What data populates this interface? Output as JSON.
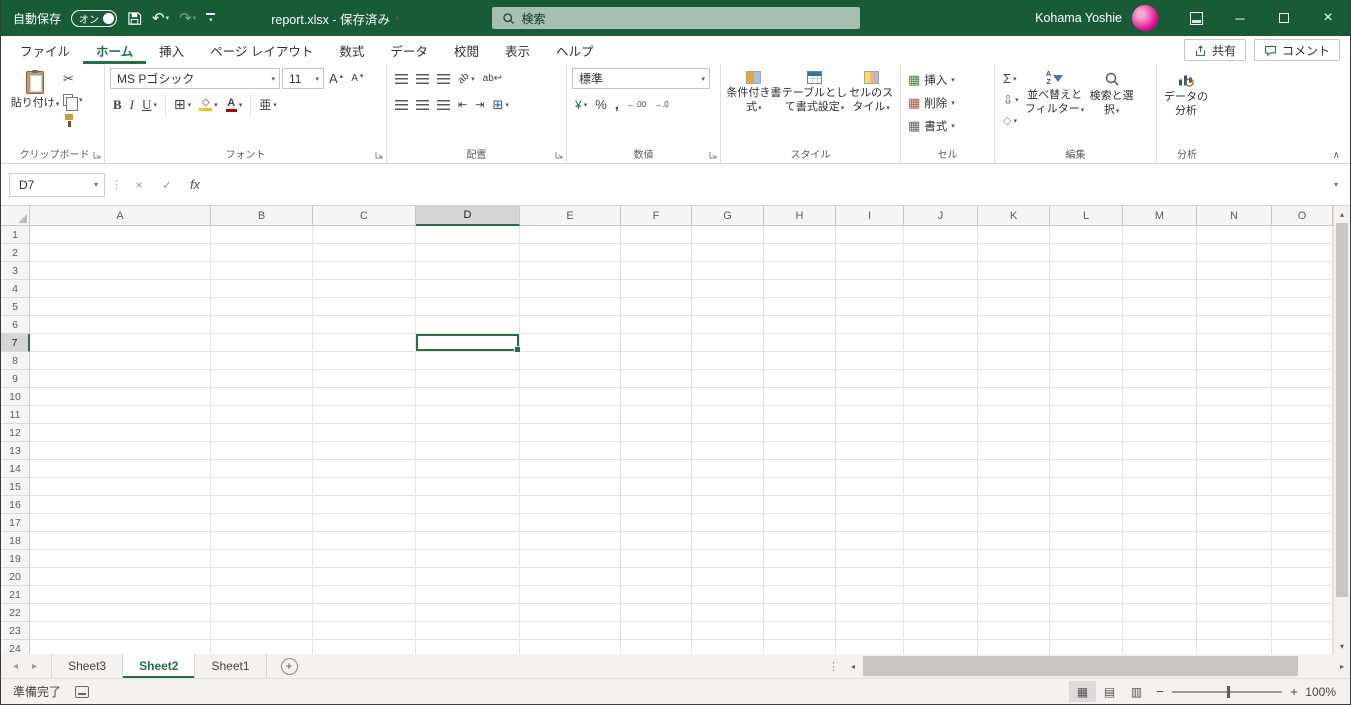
{
  "titlebar": {
    "autosave_label": "自動保存",
    "autosave_state": "オン",
    "document_title": "report.xlsx - 保存済み",
    "search_placeholder": "検索",
    "user_name": "Kohama Yoshie"
  },
  "ribbon_tabs": [
    {
      "label": "ファイル",
      "active": false
    },
    {
      "label": "ホーム",
      "active": true
    },
    {
      "label": "挿入",
      "active": false
    },
    {
      "label": "ページ レイアウト",
      "active": false
    },
    {
      "label": "数式",
      "active": false
    },
    {
      "label": "データ",
      "active": false
    },
    {
      "label": "校閲",
      "active": false
    },
    {
      "label": "表示",
      "active": false
    },
    {
      "label": "ヘルプ",
      "active": false
    }
  ],
  "ribbon_actions": {
    "share": "共有",
    "comments": "コメント"
  },
  "ribbon": {
    "clipboard": {
      "group_label": "クリップボード",
      "paste_label": "貼り付け"
    },
    "font": {
      "group_label": "フォント",
      "font_name": "MS Pゴシック",
      "font_size": "11"
    },
    "alignment": {
      "group_label": "配置"
    },
    "number": {
      "group_label": "数値",
      "number_format": "標準"
    },
    "styles": {
      "group_label": "スタイル",
      "conditional_formatting": "条件付き書式",
      "format_as_table": "テーブルとして書式設定",
      "cell_styles": "セルのスタイル"
    },
    "cells": {
      "group_label": "セル",
      "insert": "挿入",
      "delete": "削除",
      "format": "書式"
    },
    "editing": {
      "group_label": "編集",
      "sort_filter": "並べ替えとフィルター",
      "find_select": "検索と選択"
    },
    "analysis": {
      "group_label": "分析",
      "analyze_data": "データの分析"
    }
  },
  "formula_bar": {
    "name_box": "D7",
    "fx_label": "fx",
    "formula_value": ""
  },
  "grid": {
    "columns": [
      "A",
      "B",
      "C",
      "D",
      "E",
      "F",
      "G",
      "H",
      "I",
      "J",
      "K",
      "L",
      "M",
      "N",
      "O"
    ],
    "rows": [
      "1",
      "2",
      "3",
      "4",
      "5",
      "6",
      "7",
      "8",
      "9",
      "10",
      "11",
      "12",
      "13",
      "14",
      "15",
      "16",
      "17",
      "18",
      "19",
      "20",
      "21",
      "22",
      "23",
      "24"
    ],
    "selected_cell": "D7",
    "selected_column": "D",
    "selected_row": "7"
  },
  "sheet_tabs": {
    "tabs": [
      {
        "label": "Sheet3",
        "active": false
      },
      {
        "label": "Sheet2",
        "active": true
      },
      {
        "label": "Sheet1",
        "active": false
      }
    ]
  },
  "status_bar": {
    "status": "準備完了",
    "zoom_level": "100%"
  },
  "icons": {
    "chevron_down": "▾",
    "triangle_up": "▴",
    "triangle_down": "▾",
    "triangle_left": "◂",
    "triangle_right": "▸",
    "collapse_ribbon": "∧",
    "undo": "↶",
    "redo": "↷",
    "cut": "✂",
    "bold": "B",
    "italic": "I",
    "underline": "U",
    "letter_a": "A",
    "borders_grid": "⊞",
    "merge_grid": "⊞",
    "fill_diamond": "◇",
    "phonetic": "亜",
    "orientation_ab": "ab",
    "wrap_ab": "ab↩",
    "indent_decrease": "⇤",
    "indent_increase": "⇥",
    "currency_yen": "¥",
    "percent": "%",
    "comma": ",",
    "decimal_increase": "←.00",
    "decimal_decrease": "→.0",
    "autosum": "Σ",
    "fill_down": "⇩",
    "clear": "◇",
    "sort_a": "A",
    "sort_z": "Z",
    "dots_vertical": "⋮",
    "cancel": "×",
    "enter": "✓",
    "minimize": "─",
    "close": "×",
    "plus": "+",
    "minus": "−",
    "view_normal": "▦",
    "view_layout": "▤",
    "view_break": "▥",
    "cells_grid": "▦"
  }
}
